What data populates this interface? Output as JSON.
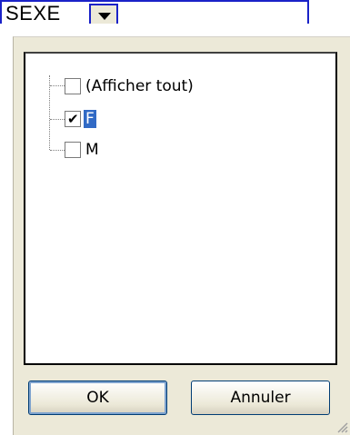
{
  "header": {
    "field_label": "SEXE",
    "dropdown_icon": "chevron-down-icon"
  },
  "filter_list": {
    "items": [
      {
        "label": "(Afficher tout)",
        "checked": false,
        "selected": false
      },
      {
        "label": "F",
        "checked": true,
        "selected": true
      },
      {
        "label": "M",
        "checked": false,
        "selected": false
      }
    ]
  },
  "buttons": {
    "ok_label": "OK",
    "cancel_label": "Annuler"
  },
  "colors": {
    "header_border": "#1a22c8",
    "selection": "#316ac5",
    "dialog_background": "#ece9d8"
  }
}
